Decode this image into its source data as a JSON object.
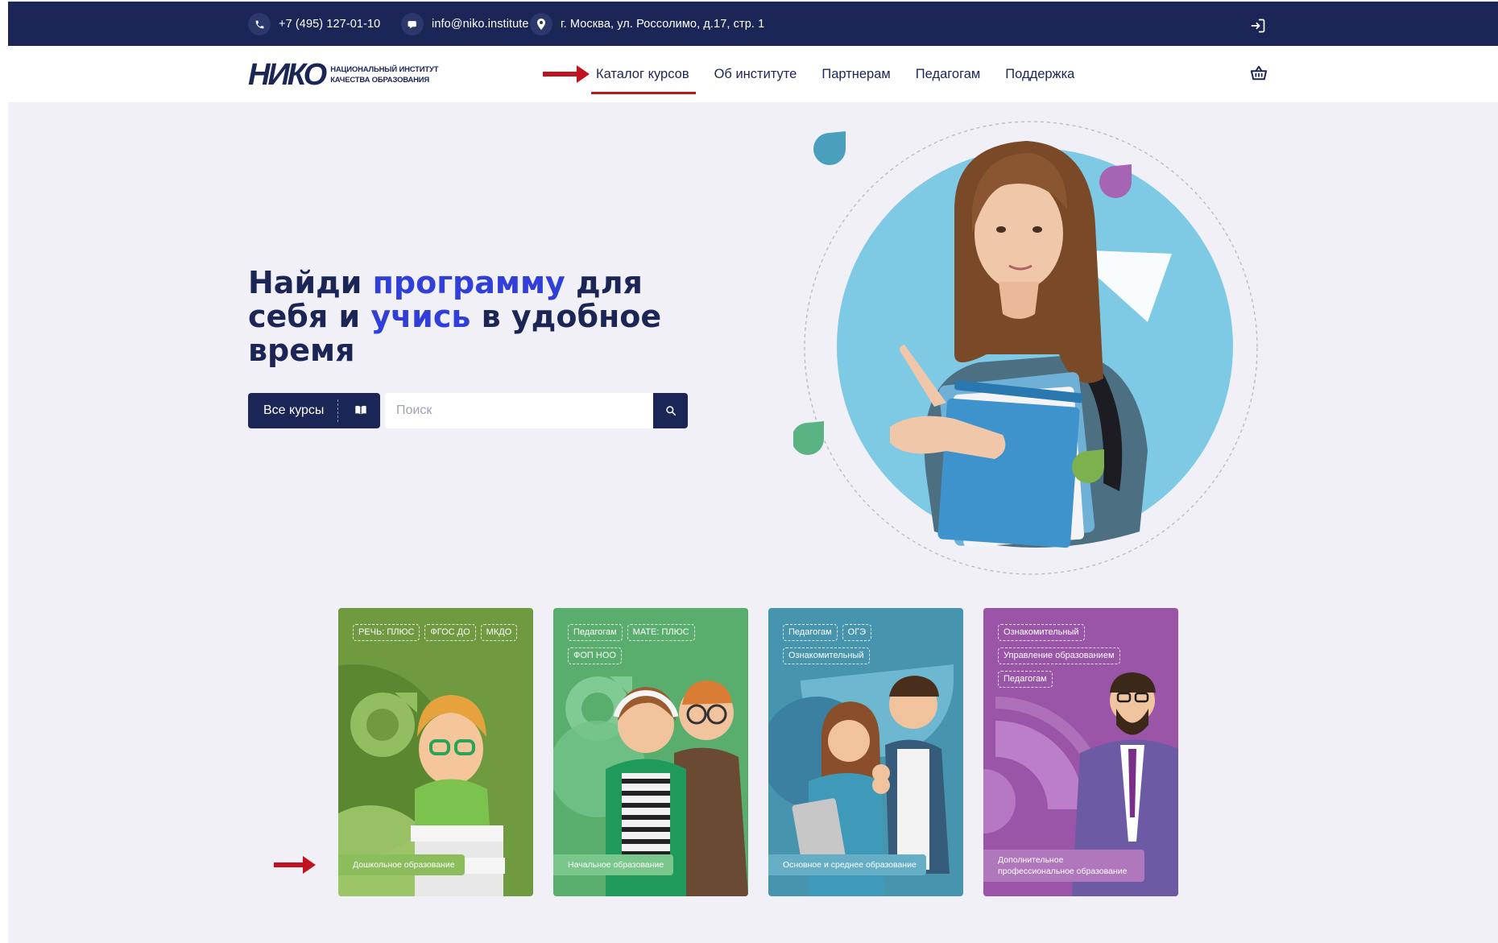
{
  "topbar": {
    "phone": "+7 (495) 127-01-10",
    "email": "info@niko.institute",
    "address": "г. Москва, ул. Россолимо, д.17, стр. 1"
  },
  "header": {
    "logo_mark": "НИКО",
    "logo_line1": "НАЦИОНАЛЬНЫЙ ИНСТИТУТ",
    "logo_line2": "КАЧЕСТВА ОБРАЗОВАНИЯ",
    "nav": [
      {
        "label": "Каталог курсов",
        "active": true
      },
      {
        "label": "Об институте"
      },
      {
        "label": "Партнерам"
      },
      {
        "label": "Педагогам"
      },
      {
        "label": "Поддержка"
      }
    ]
  },
  "hero": {
    "title_part1": "Найди ",
    "title_highlight1": "программу",
    "title_part2": " для себя и ",
    "title_highlight2": "учись",
    "title_part3": " в удобное время",
    "catalog_button": "Все курсы",
    "search_placeholder": "Поиск"
  },
  "cards": [
    {
      "tags": [
        "РЕЧЬ: ПЛЮС",
        "ФГОС ДО",
        "МКДО"
      ],
      "label": "Дошкольное образование",
      "color": "#6f9a3f"
    },
    {
      "tags": [
        "Педагогам",
        "МАТЕ: ПЛЮС",
        "ФОП НОО"
      ],
      "label": "Начальное образование",
      "color": "#59ae6d"
    },
    {
      "tags": [
        "Педагогам",
        "ОГЭ",
        "Ознакомительный"
      ],
      "label": "Основное и среднее образование",
      "color": "#4694ae"
    },
    {
      "tags": [
        "Ознакомительный",
        "Управление образованием",
        "Педагогам"
      ],
      "label": "Дополнительное профессиональное образование",
      "color": "#9a54a8"
    }
  ],
  "colors": {
    "navy": "#1b2657",
    "accent_blue": "#2f3fd8",
    "annotation_red": "#c1121f",
    "page_bg": "#f1f0f7"
  }
}
